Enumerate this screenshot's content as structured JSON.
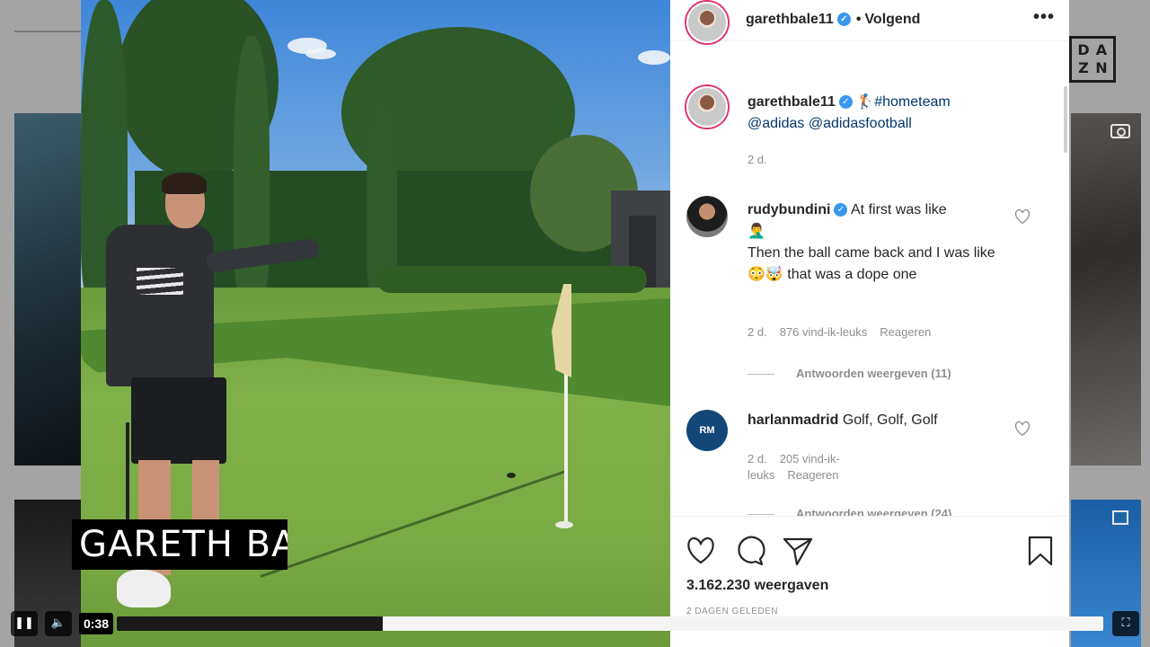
{
  "post": {
    "username": "garethbale11",
    "follow_label": "Volgend",
    "caption_hashtag": "#hometeam",
    "caption_mentions": "@adidas @adidasfootball",
    "caption_time": "2 d."
  },
  "video": {
    "banner_text": "GARETH BA",
    "current_time": "0:38",
    "progress_fraction": 0.27,
    "accent_color": "#1a1a1a"
  },
  "comments": [
    {
      "username": "rudybundini",
      "line1": "At first was like",
      "line2": "🤦‍♂️",
      "line3": "Then the ball came back and I was like 😳🤯 that was a dope one",
      "time": "2 d.",
      "likes": "876 vind-ik-leuks",
      "reply_label": "Reageren",
      "view_replies": "Antwoorden weergeven (11)"
    },
    {
      "username": "harlanmadrid",
      "text": "Golf, Golf, Golf",
      "time": "2 d.",
      "likes": "205 vind-ik-leuks",
      "reply_label": "Reageren",
      "view_replies": "Antwoorden weergeven (24)"
    }
  ],
  "actions": {
    "views": "3.162.230 weergaven",
    "time_ago": "2 DAGEN GELEDEN",
    "icons": [
      "heart-icon",
      "comment-icon",
      "share-icon",
      "bookmark-icon"
    ]
  },
  "background": {
    "logo_letters": [
      "D",
      "A",
      "Z",
      "N"
    ]
  }
}
